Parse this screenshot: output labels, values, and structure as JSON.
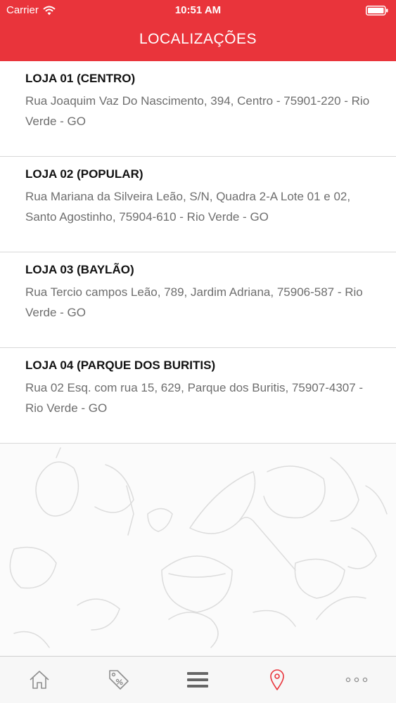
{
  "status_bar": {
    "carrier": "Carrier",
    "time": "10:51 AM"
  },
  "nav": {
    "title": "LOCALIZAÇÕES"
  },
  "locations": [
    {
      "name": "LOJA 01 (CENTRO)",
      "address": "Rua Joaquim Vaz Do Nascimento, 394, Centro - 75901-220 - Rio Verde - GO"
    },
    {
      "name": "LOJA 02 (POPULAR)",
      "address": "Rua Mariana da Silveira Leão, S/N, Quadra 2-A Lote 01 e 02, Santo Agostinho, 75904-610 - Rio Verde - GO"
    },
    {
      "name": "LOJA 03 (BAYLÃO)",
      "address": "Rua Tercio campos Leão, 789, Jardim Adriana, 75906-587 - Rio Verde - GO"
    },
    {
      "name": "LOJA 04 (PARQUE DOS BURITIS)",
      "address": "Rua 02 Esq. com rua 15, 629, Parque dos Buritis, 75907-4307 - Rio Verde - GO"
    }
  ],
  "tab_bar": {
    "tabs": [
      {
        "icon": "home-icon",
        "active": false
      },
      {
        "icon": "tag-percent-icon",
        "active": false
      },
      {
        "icon": "menu-icon",
        "active": false
      },
      {
        "icon": "location-pin-icon",
        "active": true
      },
      {
        "icon": "more-icon",
        "active": false
      }
    ]
  },
  "colors": {
    "header": "#e9343b",
    "active_tab": "#e9343b",
    "inactive_tab": "#8e8e8e",
    "address_text": "#6e6e6e"
  }
}
